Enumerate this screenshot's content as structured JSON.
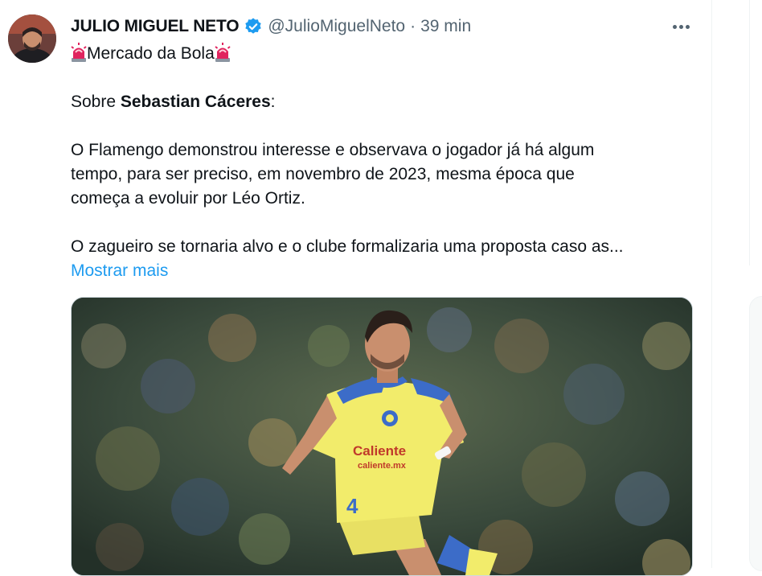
{
  "tweet": {
    "author_name": "JULIO MIGUEL NETO",
    "handle": "@JulioMiguelNeto",
    "separator": "·",
    "time": "39 min",
    "lines": {
      "title_text": "Mercado da Bola",
      "about_prefix": "Sobre ",
      "about_name": "Sebastian Cáceres",
      "about_suffix": ":",
      "p1_l1": "O Flamengo demonstrou interesse e observava o jogador já há algum",
      "p1_l2": "tempo, para ser preciso, em novembro de 2023, mesma época que",
      "p1_l3": "começa a evoluir por Léo Ortiz.",
      "p2_l1": "O zagueiro se tornaria alvo e o clube formalizaria uma proposta caso as..."
    },
    "show_more": "Mostrar mais",
    "media": {
      "jersey_sponsor": "Caliente",
      "jersey_sponsor_sub": "caliente.mx",
      "shorts_number": "4"
    }
  },
  "icons": {
    "verified": "verified-badge-icon",
    "more": "more-options-icon",
    "siren": "siren-emoji-icon"
  },
  "colors": {
    "link": "#1d9bf0",
    "verified": "#1d9bf0",
    "secondary_text": "#536471",
    "jersey": "#f2ec6b"
  }
}
